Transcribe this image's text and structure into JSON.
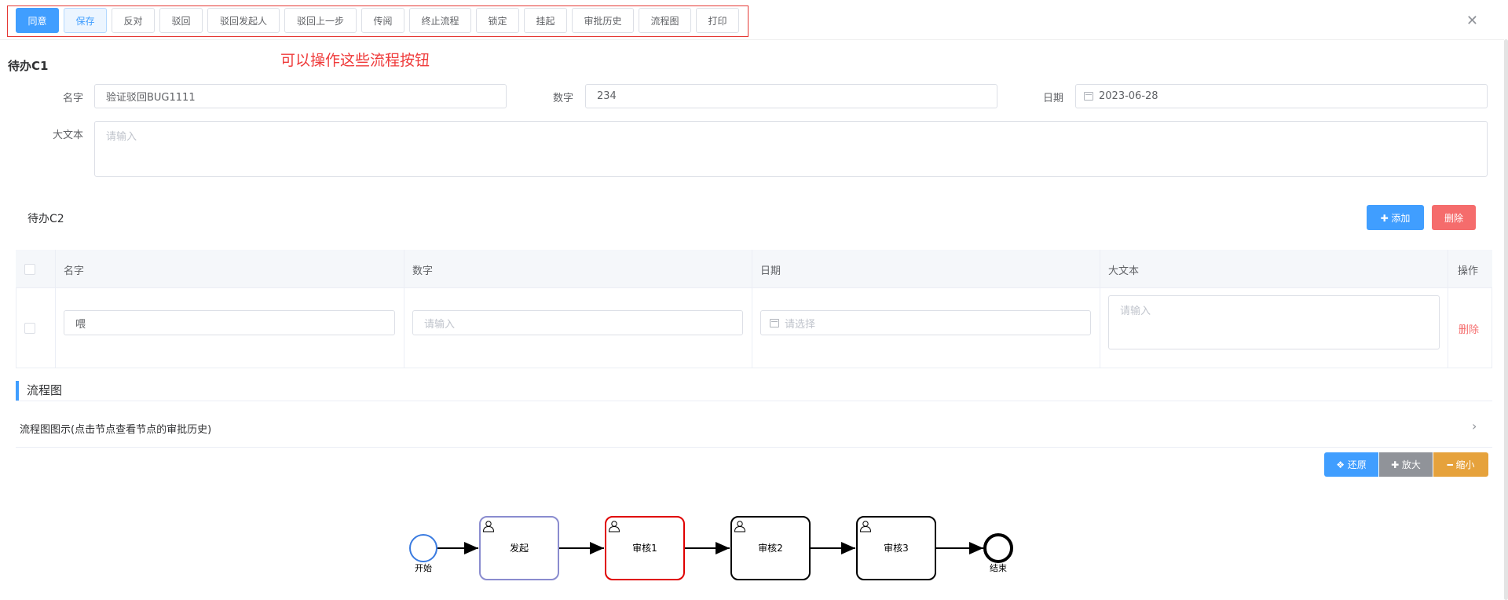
{
  "toolbar": {
    "buttons": [
      "同意",
      "保存",
      "反对",
      "驳回",
      "驳回发起人",
      "驳回上一步",
      "传阅",
      "终止流程",
      "锁定",
      "挂起",
      "审批历史",
      "流程图",
      "打印"
    ]
  },
  "note": "可以操作这些流程按钮",
  "c1": {
    "title": "待办C1",
    "name_label": "名字",
    "name_value": "验证驳回BUG1111",
    "number_label": "数字",
    "number_value": "234",
    "date_label": "日期",
    "date_value": "2023-06-28",
    "bigtext_label": "大文本",
    "bigtext_placeholder": "请输入"
  },
  "c2": {
    "title": "待办C2",
    "add_label": "✚ 添加",
    "delete_label": "删除",
    "columns": [
      "名字",
      "数字",
      "日期",
      "大文本",
      "操作"
    ],
    "row": {
      "name": "喂",
      "number_placeholder": "请输入",
      "date_placeholder": "请选择",
      "bigtext_placeholder": "请输入",
      "action": "删除"
    }
  },
  "flow": {
    "section_title": "流程图",
    "collapse_title": "流程图图示(点击节点查看节点的审批历史)",
    "restore_label": "❖ 还原",
    "zoomin_label": "✚ 放大",
    "zoomout_label": "━ 缩小",
    "start_label": "开始",
    "end_label": "结束",
    "nodes": [
      "发起",
      "审核1",
      "审核2",
      "审核3"
    ]
  },
  "colors": {
    "primary": "#409eff",
    "danger": "#f56c6c",
    "warning": "#e6a23c",
    "info": "#909399",
    "highlight": "#e53935"
  },
  "icons": [
    "calendar-icon",
    "close-icon",
    "chevron-right-icon",
    "user-task-icon"
  ]
}
